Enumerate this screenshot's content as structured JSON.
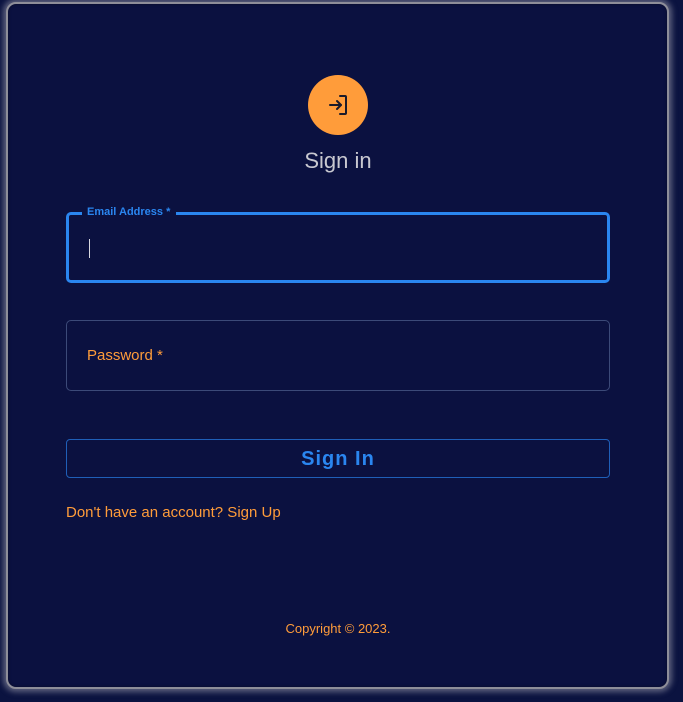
{
  "header": {
    "icon": "login-icon",
    "title": "Sign in"
  },
  "form": {
    "email": {
      "label": "Email Address *",
      "value": ""
    },
    "password": {
      "placeholder": "Password *",
      "value": ""
    },
    "submit_label": "Sign In",
    "signup_link": "Don't have an account? Sign Up"
  },
  "footer": {
    "copyright": "Copyright © 2023."
  },
  "colors": {
    "background": "#0b1140",
    "accent_orange": "#ff9c3a",
    "accent_blue": "#2a86f0"
  }
}
